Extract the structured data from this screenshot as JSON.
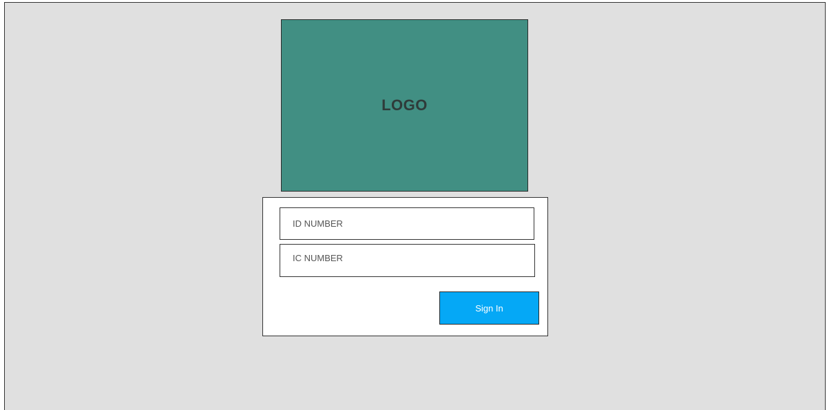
{
  "logo": {
    "text": "LOGO",
    "background_color": "#418f83"
  },
  "login_form": {
    "id_number_field": {
      "value": "",
      "placeholder": "ID NUMBER"
    },
    "ic_number_field": {
      "value": "",
      "placeholder": "IC NUMBER"
    },
    "sign_in_button": {
      "label": "Sign In",
      "color": "#05a8f6"
    }
  },
  "colors": {
    "page_background": "#e0e0e0",
    "panel_background": "#ffffff",
    "border": "#333333"
  }
}
